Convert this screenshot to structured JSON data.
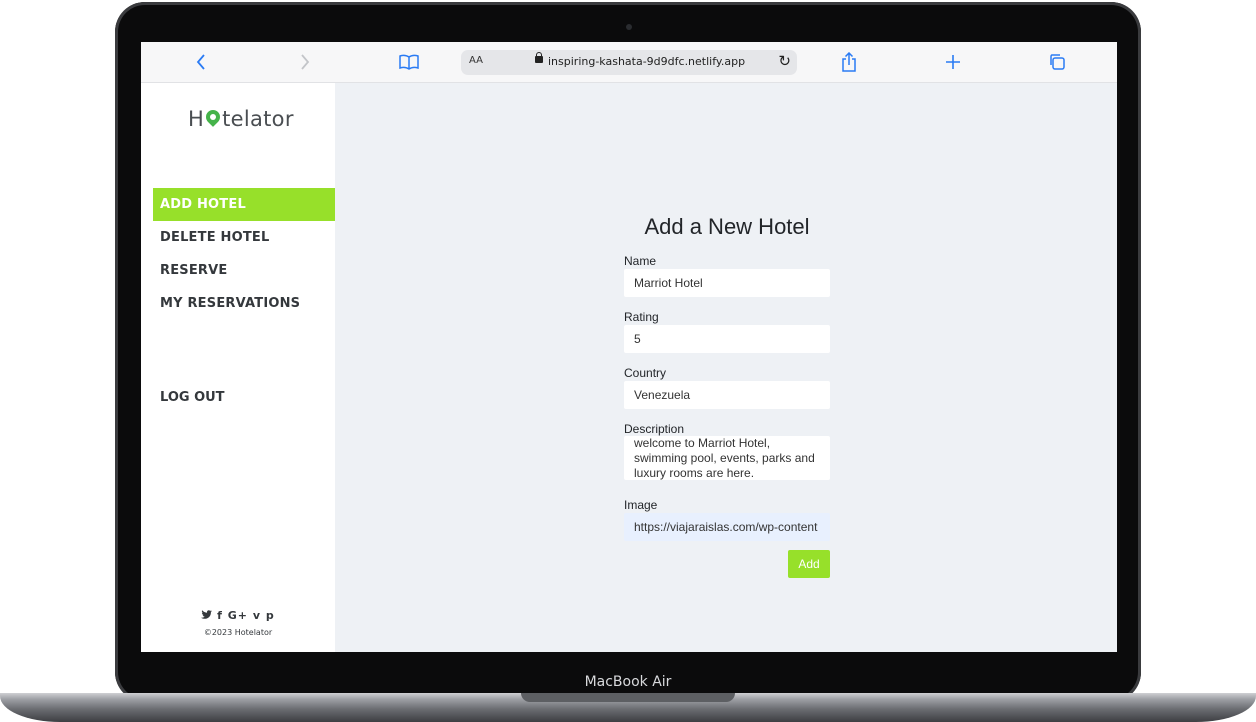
{
  "device": {
    "label": "MacBook Air"
  },
  "browser": {
    "text_size_label": "AA",
    "url": "inspiring-kashata-9d9dfc.netlify.app"
  },
  "sidebar": {
    "logo": {
      "prefix": "H",
      "suffix": "telator"
    },
    "nav": [
      {
        "label": "ADD HOTEL",
        "active": true
      },
      {
        "label": "DELETE HOTEL"
      },
      {
        "label": "RESERVE"
      },
      {
        "label": "MY RESERVATIONS"
      }
    ],
    "logout_label": "LOG OUT",
    "social_icons": [
      "twitter-icon",
      "facebook-icon",
      "google-plus-icon",
      "vimeo-icon",
      "pinterest-icon"
    ],
    "copyright": "©2023 Hotelator"
  },
  "form": {
    "title": "Add a New Hotel",
    "fields": {
      "name": {
        "label": "Name",
        "value": "Marriot Hotel"
      },
      "rating": {
        "label": "Rating",
        "value": "5"
      },
      "country": {
        "label": "Country",
        "value": "Venezuela"
      },
      "description": {
        "label": "Description",
        "value": "welcome to Marriot Hotel, swimming pool, events, parks and luxury rooms are here."
      },
      "image": {
        "label": "Image",
        "value": "https://viajaraislas.com/wp-content"
      }
    },
    "submit_label": "Add"
  },
  "colors": {
    "accent": "#97e02a",
    "logo_pin": "#45b34a",
    "link_blue": "#2a7bf4"
  }
}
